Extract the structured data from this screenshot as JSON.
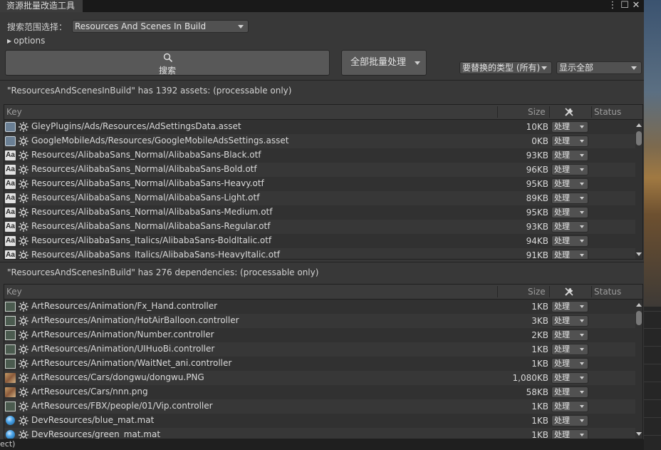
{
  "window": {
    "title": "资源批量改造工具",
    "controls": {
      "menu": "⋮",
      "maximize": "☐",
      "close": "✕"
    }
  },
  "toolbar": {
    "scope_label": "搜索范围选择：",
    "scope_value": "Resources And Scenes In Build",
    "options_label": "options",
    "search_label": "搜索",
    "batch_label": "全部批量处理",
    "replace_type": "要替换的类型 (所有)",
    "display_filter": "显示全部"
  },
  "columns": {
    "key": "Key",
    "size": "Size",
    "status": "Status"
  },
  "process_label": "处理",
  "assets_section": {
    "title": "\"ResourcesAndScenesInBuild\" has 1392 assets: (processable only)",
    "rows": [
      {
        "icon": "asset",
        "path": "GleyPlugins/Ads/Resources/AdSettingsData.asset",
        "size": "10KB"
      },
      {
        "icon": "asset",
        "path": "GoogleMobileAds/Resources/GoogleMobileAdsSettings.asset",
        "size": "0KB"
      },
      {
        "icon": "font",
        "path": "Resources/AlibabaSans_Normal/AlibabaSans-Black.otf",
        "size": "93KB"
      },
      {
        "icon": "font",
        "path": "Resources/AlibabaSans_Normal/AlibabaSans-Bold.otf",
        "size": "96KB"
      },
      {
        "icon": "font",
        "path": "Resources/AlibabaSans_Normal/AlibabaSans-Heavy.otf",
        "size": "95KB"
      },
      {
        "icon": "font",
        "path": "Resources/AlibabaSans_Normal/AlibabaSans-Light.otf",
        "size": "89KB"
      },
      {
        "icon": "font",
        "path": "Resources/AlibabaSans_Normal/AlibabaSans-Medium.otf",
        "size": "95KB"
      },
      {
        "icon": "font",
        "path": "Resources/AlibabaSans_Normal/AlibabaSans-Regular.otf",
        "size": "93KB"
      },
      {
        "icon": "font",
        "path": "Resources/AlibabaSans_Italics/AlibabaSans-BoldItalic.otf",
        "size": "94KB"
      },
      {
        "icon": "font",
        "path": "Resources/AlibabaSans_Italics/AlibabaSans-HeavyItalic.otf",
        "size": "91KB"
      }
    ]
  },
  "deps_section": {
    "title": "\"ResourcesAndScenesInBuild\" has 276 dependencies: (processable only)",
    "rows": [
      {
        "icon": "ctrl",
        "path": "ArtResources/Animation/Fx_Hand.controller",
        "size": "1KB"
      },
      {
        "icon": "ctrl",
        "path": "ArtResources/Animation/HotAirBalloon.controller",
        "size": "3KB"
      },
      {
        "icon": "ctrl",
        "path": "ArtResources/Animation/Number.controller",
        "size": "2KB"
      },
      {
        "icon": "ctrl",
        "path": "ArtResources/Animation/UIHuoBi.controller",
        "size": "1KB"
      },
      {
        "icon": "ctrl",
        "path": "ArtResources/Animation/WaitNet_ani.controller",
        "size": "1KB"
      },
      {
        "icon": "img",
        "path": "ArtResources/Cars/dongwu/dongwu.PNG",
        "size": "1,080KB"
      },
      {
        "icon": "img",
        "path": "ArtResources/Cars/nnn.png",
        "size": "58KB"
      },
      {
        "icon": "ctrl",
        "path": "ArtResources/FBX/people/01/Vip.controller",
        "size": "1KB"
      },
      {
        "icon": "mat",
        "path": "DevResources/blue_mat.mat",
        "size": "1KB"
      },
      {
        "icon": "mat",
        "path": "DevResources/green_mat.mat",
        "size": "1KB"
      }
    ]
  },
  "statusbar": {
    "text": "ect)"
  }
}
